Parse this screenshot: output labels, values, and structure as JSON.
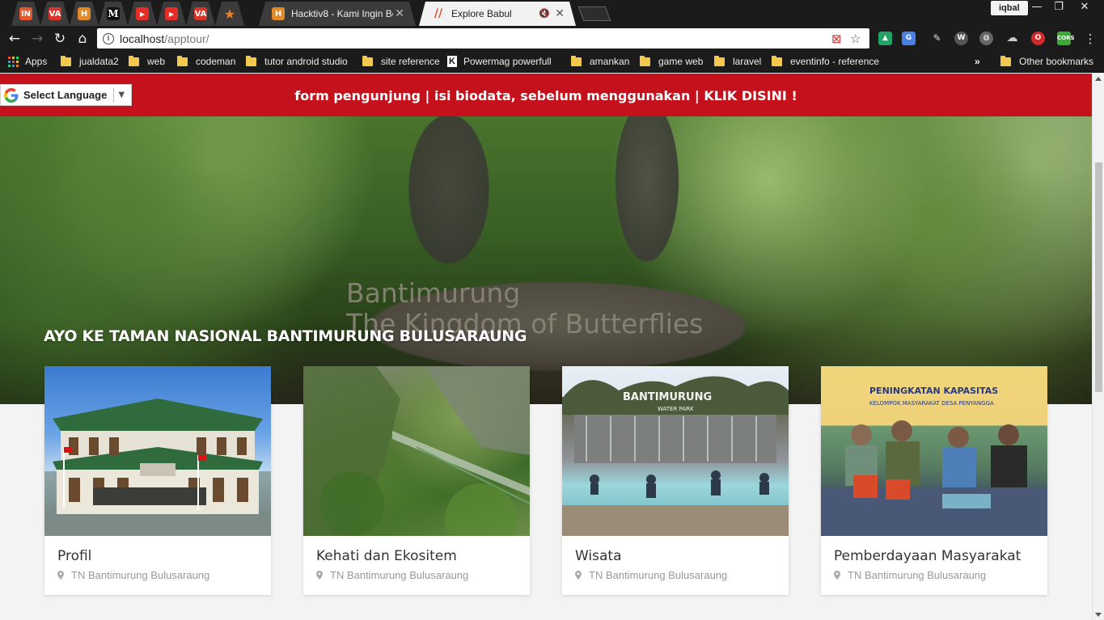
{
  "browser": {
    "tabs": [
      {
        "type": "pinned",
        "icon": "idn-icon",
        "badge": "IN",
        "color": "#e4572e"
      },
      {
        "type": "pinned",
        "icon": "va-icon",
        "badge": "VA",
        "color": "#d8352a"
      },
      {
        "type": "pinned",
        "icon": "bug-icon",
        "badge": "H",
        "color": "#e08a2c"
      },
      {
        "type": "pinned",
        "icon": "medium-icon",
        "badge": "M",
        "color": "#111111"
      },
      {
        "type": "pinned",
        "icon": "youtube-icon",
        "badge": "▶",
        "color": "#e52d27"
      },
      {
        "type": "pinned",
        "icon": "youtube-icon",
        "badge": "▶",
        "color": "#e52d27"
      },
      {
        "type": "pinned",
        "icon": "va-icon",
        "badge": "VA",
        "color": "#d8352a"
      },
      {
        "type": "pinned",
        "icon": "star-icon",
        "badge": "★",
        "color": "#3b3b3b"
      },
      {
        "type": "normal",
        "icon": "bug-icon",
        "label": "Hacktiv8 - Kami Ingin Bel",
        "active": false
      },
      {
        "type": "normal",
        "icon": "slash-icon",
        "label": "Explore Babul",
        "active": true
      }
    ],
    "profile_name": "iqbal",
    "address": {
      "host": "localhost",
      "path": "/apptour/"
    },
    "bookmarks": [
      {
        "label": "Apps",
        "icon": "apps-icon"
      },
      {
        "label": "jualdata2",
        "icon": "folder-icon"
      },
      {
        "label": "web",
        "icon": "folder-icon"
      },
      {
        "label": "codeman",
        "icon": "folder-icon"
      },
      {
        "label": "tutor android studio",
        "icon": "folder-icon"
      },
      {
        "label": "site reference",
        "icon": "folder-icon"
      },
      {
        "label": "Powermag powerfull",
        "icon": "k-icon"
      },
      {
        "label": "amankan",
        "icon": "folder-icon"
      },
      {
        "label": "game web",
        "icon": "folder-icon"
      },
      {
        "label": "laravel",
        "icon": "folder-icon"
      },
      {
        "label": "eventinfo - reference",
        "icon": "folder-icon"
      }
    ],
    "more_label": "»",
    "other_bookmarks": "Other bookmarks"
  },
  "page": {
    "translate_label": "Select Language",
    "banner_text": "form pengunjung | isi biodata, sebelum menggunakan | KLIK DISINI !",
    "hero_stone_line1": "Bantimurung",
    "hero_stone_line2": "The Kingdom of Butterflies",
    "hero_title": "AYO KE TAMAN NASIONAL BANTIMURUNG BULUSARAUNG",
    "cards": [
      {
        "title": "Profil",
        "location": "TN Bantimurung Bulusaraung",
        "image": "office-building"
      },
      {
        "title": "Kehati dan Ekositem",
        "location": "TN Bantimurung Bulusaraung",
        "image": "karst-cliff"
      },
      {
        "title": "Wisata",
        "location": "TN Bantimurung Bulusaraung",
        "image": "water-park",
        "image_sign": "BANTIMURUNG",
        "image_sign_sub": "WATER PARK"
      },
      {
        "title": "Pemberdayaan Masyarakat",
        "location": "TN Bantimurung Bulusaraung",
        "image": "community-meeting",
        "image_sign": "PENINGKATAN KAPASITAS",
        "image_sign_sub": "KELOMPOK MASYARAKAT DESA PENYANGGA"
      }
    ]
  },
  "colors": {
    "banner": "#c4111b",
    "browser_dark": "#1b1b1b",
    "card_bg": "#ffffff"
  }
}
